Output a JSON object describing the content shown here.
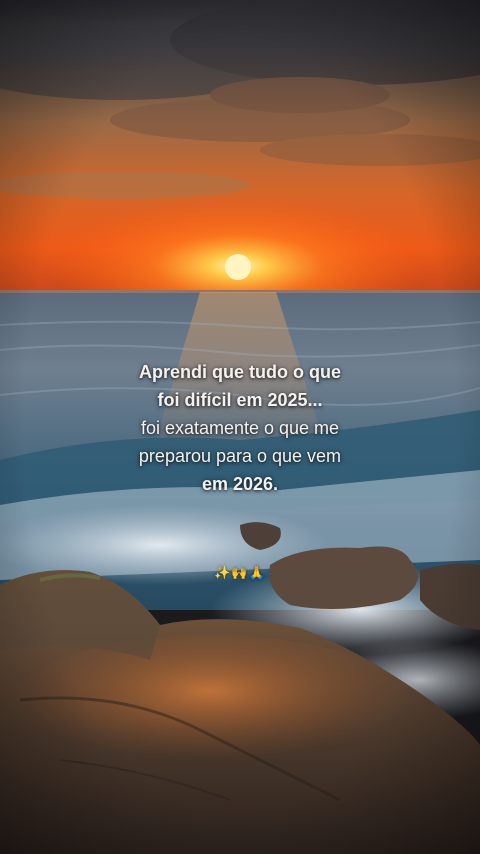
{
  "caption": {
    "line1": "Aprendi que tudo o que",
    "line2": "foi difícil em 2025...",
    "line3": "foi exatamente o que me",
    "line4": "preparou para o que vem",
    "line5": "em 2026."
  },
  "emojis": "✨🙌🙏",
  "colors": {
    "sun": "#ffe27a",
    "sky_orange": "#e8641f",
    "sea": "#4a6e86",
    "rock": "#5a4637"
  }
}
